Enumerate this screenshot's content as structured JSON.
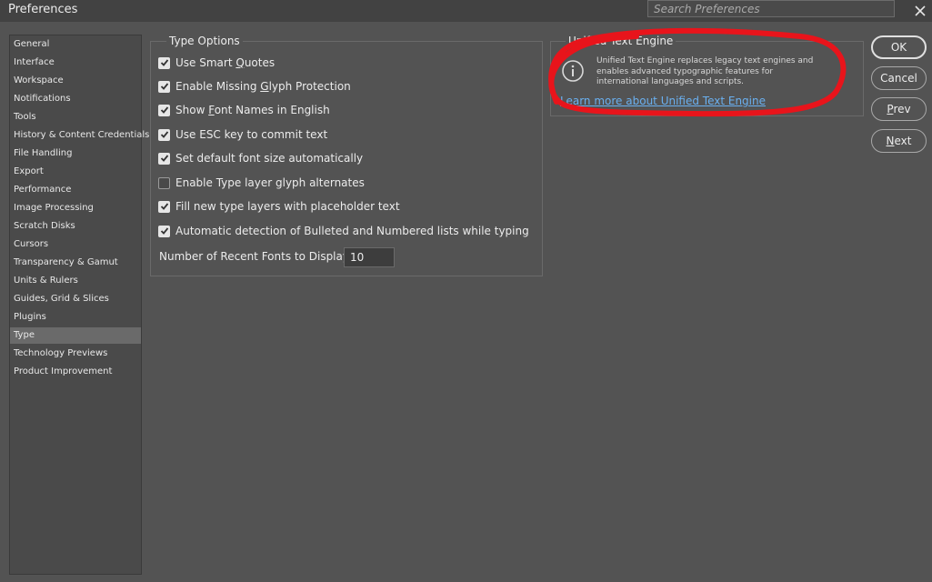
{
  "window": {
    "title": "Preferences",
    "search_placeholder": "Search Preferences"
  },
  "sidebar": {
    "items": [
      {
        "label": "General"
      },
      {
        "label": "Interface"
      },
      {
        "label": "Workspace"
      },
      {
        "label": "Notifications"
      },
      {
        "label": "Tools"
      },
      {
        "label": "History & Content Credentials"
      },
      {
        "label": "File Handling"
      },
      {
        "label": "Export"
      },
      {
        "label": "Performance"
      },
      {
        "label": "Image Processing"
      },
      {
        "label": "Scratch Disks"
      },
      {
        "label": "Cursors"
      },
      {
        "label": "Transparency & Gamut"
      },
      {
        "label": "Units & Rulers"
      },
      {
        "label": "Guides, Grid & Slices"
      },
      {
        "label": "Plugins"
      },
      {
        "label": "Type"
      },
      {
        "label": "Technology Previews"
      },
      {
        "label": "Product Improvement"
      }
    ],
    "selected": "Type"
  },
  "type_options": {
    "group_title": "Type Options",
    "options": [
      {
        "pre": "Use Smart ",
        "u": "Q",
        "post": "uotes",
        "checked": true
      },
      {
        "pre": "Enable Missing ",
        "u": "G",
        "post": "lyph Protection",
        "checked": true
      },
      {
        "pre": "Show ",
        "u": "F",
        "post": "ont Names in English",
        "checked": true
      },
      {
        "pre": "Use ESC key to commit text",
        "u": "",
        "post": "",
        "checked": true
      },
      {
        "pre": "Set default font size automatically",
        "u": "",
        "post": "",
        "checked": true
      },
      {
        "pre": "Enable Type layer glyph alternates",
        "u": "",
        "post": "",
        "checked": false
      },
      {
        "pre": "Fill new type layers with placeholder text",
        "u": "",
        "post": "",
        "checked": true
      },
      {
        "pre": "Automatic detection of Bulleted and Numbered lists while typing",
        "u": "",
        "post": "",
        "checked": true
      }
    ],
    "recent_fonts_label": "Number of Recent Fonts to Display:",
    "recent_fonts_value": "10"
  },
  "unified_text_engine": {
    "title": "Unified Text Engine",
    "description": "Unified Text Engine replaces legacy text engines and enables advanced typographic features for international languages and scripts.",
    "link_text": "Learn more about Unified Text Engine"
  },
  "buttons": {
    "ok": "OK",
    "cancel": "Cancel",
    "prev_u": "P",
    "prev_rest": "rev",
    "next_u": "N",
    "next_rest": "ext"
  },
  "colors": {
    "background": "#535353",
    "titlebar": "#424242",
    "selected_item": "#6a6a6a",
    "link": "#6ab0f0",
    "annotation": "#e8141b"
  },
  "icons": [
    "close-icon",
    "info-icon",
    "checkmark-icon"
  ]
}
